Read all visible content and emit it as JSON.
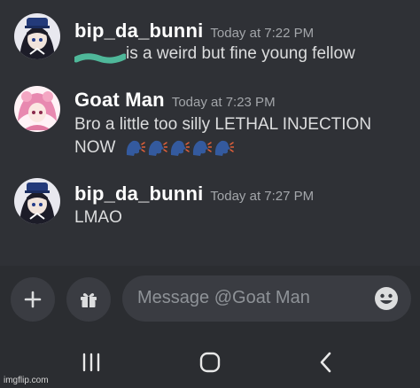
{
  "messages": [
    {
      "username": "bip_da_bunni",
      "timestamp": "Today at 7:22 PM",
      "text": "is a weird but fine young fellow",
      "avatar_icon": "anime-girl-avatar-icon"
    },
    {
      "username": "Goat Man",
      "timestamp": "Today at 7:23 PM",
      "text_line1": "Bro a little too silly LETHAL INJECTION",
      "text_line2": "NOW",
      "emoji_count": 5,
      "emoji_icon": "speaking-head-emoji-icon",
      "avatar_icon": "pink-hair-anime-avatar-icon"
    },
    {
      "username": "bip_da_bunni",
      "timestamp": "Today at 7:27 PM",
      "text": "LMAO",
      "avatar_icon": "anime-girl-avatar-icon"
    }
  ],
  "composer": {
    "placeholder": "Message @Goat Man",
    "plus_icon": "plus-icon",
    "gift_icon": "gift-icon",
    "emoji_icon": "smiley-face-icon"
  },
  "navbar": {
    "recents_icon": "recent-apps-icon",
    "home_icon": "home-icon",
    "back_icon": "back-chevron-icon"
  },
  "watermark": "imgflip.com",
  "colors": {
    "background": "#2f3136",
    "composer_bg": "#2b2d31",
    "input_bg": "#3a3c42",
    "username": "#ffffff",
    "timestamp": "#a3a6aa",
    "censor": "#4fb89a",
    "emoji": "#345a9e"
  }
}
